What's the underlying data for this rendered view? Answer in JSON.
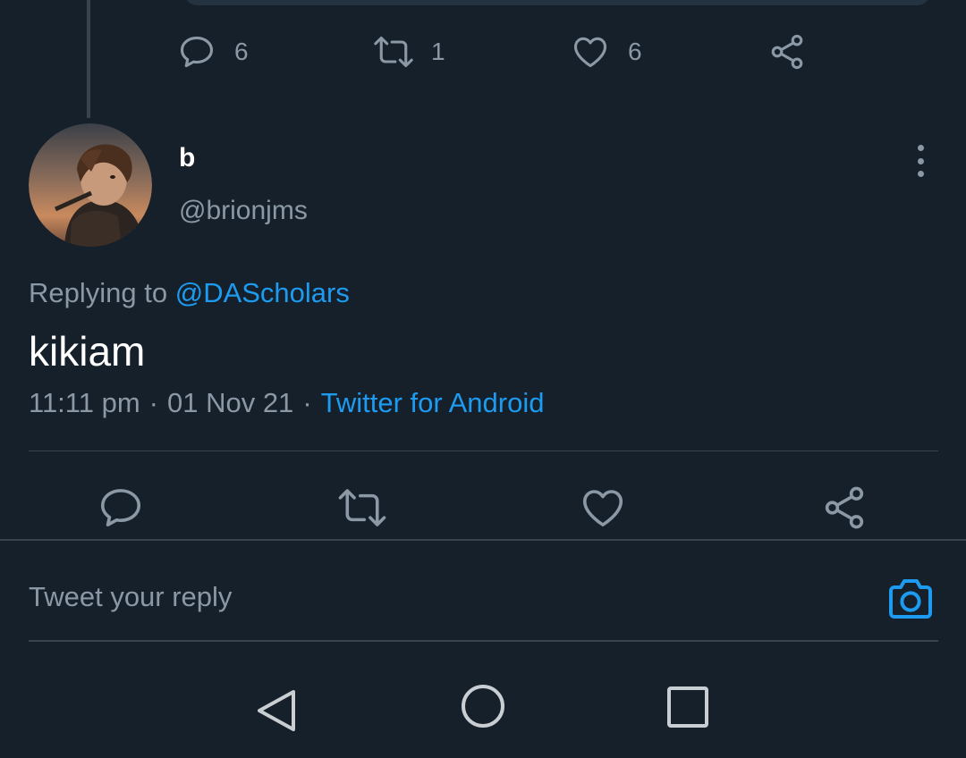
{
  "previous_tweet": {
    "reply_count": "6",
    "retweet_count": "1",
    "like_count": "6"
  },
  "tweet": {
    "display_name": "b",
    "handle": "@brionjms",
    "replying_label": "Replying to",
    "replying_to": "@DAScholars",
    "text": "kikiam",
    "time": "11:11 pm",
    "date": "01 Nov 21",
    "source": "Twitter for Android",
    "meta_separator": "·"
  },
  "reply_box": {
    "placeholder": "Tweet your reply"
  },
  "icons": {
    "reply": "reply-icon",
    "retweet": "retweet-icon",
    "like": "heart-icon",
    "share": "share-icon",
    "more": "more-vertical-icon",
    "camera": "camera-icon",
    "back": "nav-back-icon",
    "home": "nav-home-icon",
    "recents": "nav-recents-icon"
  },
  "colors": {
    "background": "#15202b",
    "accent": "#1d9bf0",
    "secondary_text": "#8b98a5",
    "divider": "#38444d"
  }
}
